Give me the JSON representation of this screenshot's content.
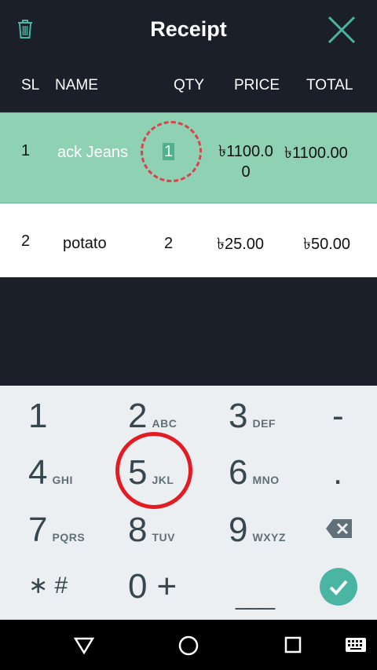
{
  "header": {
    "title": "Receipt",
    "icons": [
      "trash-icon",
      "close-icon"
    ]
  },
  "columns": [
    "SL",
    "NAME",
    "QTY",
    "PRICE",
    "TOTAL"
  ],
  "rows": [
    {
      "sl": "1",
      "name": "Black Jeans",
      "qty": "1",
      "price_line1": "৳1100.0",
      "price_line2": "0",
      "total": "৳1100.00",
      "selected": true
    },
    {
      "sl": "2",
      "name": "potato",
      "qty": "2",
      "price": "৳25.00",
      "total": "৳50.00",
      "selected": false
    }
  ],
  "keypad": {
    "keys": [
      {
        "num": "1",
        "sub": ""
      },
      {
        "num": "2",
        "sub": "ABC"
      },
      {
        "num": "3",
        "sub": "DEF"
      },
      {
        "num": "-",
        "sub": ""
      },
      {
        "num": "4",
        "sub": "GHI"
      },
      {
        "num": "5",
        "sub": "JKL"
      },
      {
        "num": "6",
        "sub": "MNO"
      },
      {
        "num": ".",
        "sub": ""
      },
      {
        "num": "7",
        "sub": "PQRS"
      },
      {
        "num": "8",
        "sub": "TUV"
      },
      {
        "num": "9",
        "sub": "WXYZ"
      },
      {
        "num": "0",
        "sub": "+"
      }
    ],
    "special": {
      "star_hash": "∗ #",
      "space": "___"
    }
  },
  "colors": {
    "background": "#1b1f2a",
    "selected_row": "#8fd1b3",
    "accent": "#4bb5a3",
    "annotation": "#e31b23"
  },
  "navbar": {
    "icons": [
      "back-icon",
      "home-icon",
      "recents-icon",
      "keyboard-icon"
    ]
  }
}
